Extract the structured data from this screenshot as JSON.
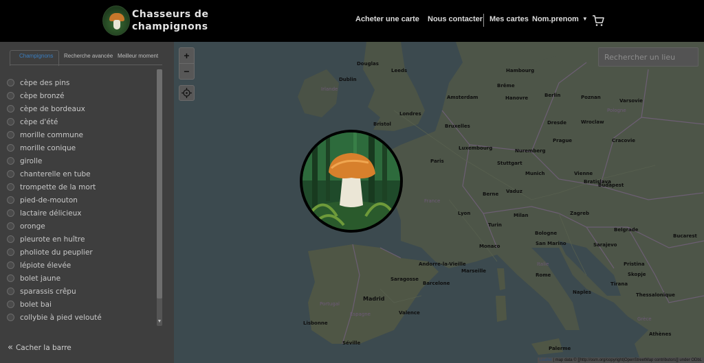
{
  "header": {
    "brand_line1": "Chasseurs de",
    "brand_line2": "champignons",
    "nav": {
      "buy_map": "Acheter une carte",
      "contact": "Nous contacter",
      "my_maps": "Mes cartes",
      "user": "Nom.prenom"
    }
  },
  "sidebar": {
    "tabs": [
      "Champignons",
      "Recherche avancée",
      "Meilleur moment"
    ],
    "active_tab": "Champignons",
    "items": [
      "cèpe des pins",
      "cèpe bronzé",
      "cèpe de bordeaux",
      "cèpe d'été",
      "morille commune",
      "morille conique",
      "girolle",
      "chanterelle en tube",
      "trompette de la mort",
      "pied-de-mouton",
      "lactaire délicieux",
      "oronge",
      "pleurote en huître",
      "pholiote du peuplier",
      "lépiote élevée",
      "bolet jaune",
      "sparassis crêpu",
      "bolet bai",
      "collybie à pied velouté"
    ],
    "hide_label": "Cacher la barre"
  },
  "map": {
    "zoom_in": "+",
    "zoom_out": "−",
    "search_placeholder": "Rechercher un lieu",
    "attribution_link": "Leaflet",
    "attribution_text": " | map data © [[http://osm.org/copyright|OpenStreetMap contributors]] under ODbL",
    "cities": [
      {
        "name": "Douglas"
      },
      {
        "name": "Leeds"
      },
      {
        "name": "Dublin"
      },
      {
        "name": "Irlande"
      },
      {
        "name": "Londres"
      },
      {
        "name": "Bristol"
      },
      {
        "name": "Amsterdam"
      },
      {
        "name": "Bruxelles"
      },
      {
        "name": "Luxembourg"
      },
      {
        "name": "Paris"
      },
      {
        "name": "Stuttgart"
      },
      {
        "name": "Nuremberg"
      },
      {
        "name": "Munich"
      },
      {
        "name": "Berne"
      },
      {
        "name": "Vaduz"
      },
      {
        "name": "Lyon"
      },
      {
        "name": "Turin"
      },
      {
        "name": "Milan"
      },
      {
        "name": "Monaco"
      },
      {
        "name": "Andorre-la-Vieille"
      },
      {
        "name": "Saragosse"
      },
      {
        "name": "Barcelone"
      },
      {
        "name": "Madrid"
      },
      {
        "name": "Valence"
      },
      {
        "name": "Lisbonne"
      },
      {
        "name": "Séville"
      },
      {
        "name": "Rome"
      },
      {
        "name": "Naples"
      },
      {
        "name": "Berlin"
      },
      {
        "name": "Hanovre"
      },
      {
        "name": "Brême"
      },
      {
        "name": "Hambourg"
      },
      {
        "name": "Poznan"
      },
      {
        "name": "Varsovie"
      },
      {
        "name": "Dresde"
      },
      {
        "name": "Wroclaw"
      },
      {
        "name": "Prague"
      },
      {
        "name": "Cracovie"
      },
      {
        "name": "Vienne"
      },
      {
        "name": "Bratislava"
      },
      {
        "name": "Budapest"
      },
      {
        "name": "Zagreb"
      },
      {
        "name": "Belgrade"
      },
      {
        "name": "Sarajevo"
      },
      {
        "name": "Bucarest"
      },
      {
        "name": "Pristina"
      },
      {
        "name": "Skopje"
      },
      {
        "name": "Tirana"
      },
      {
        "name": "Athènes"
      },
      {
        "name": "Thessalonique"
      },
      {
        "name": "Marseille"
      },
      {
        "name": "Bologne"
      },
      {
        "name": "San Marino"
      },
      {
        "name": "Palerme"
      },
      {
        "name": "Portugal"
      },
      {
        "name": "Espagne"
      },
      {
        "name": "France"
      },
      {
        "name": "Italie"
      },
      {
        "name": "Pologne"
      },
      {
        "name": "Grèce"
      }
    ]
  }
}
